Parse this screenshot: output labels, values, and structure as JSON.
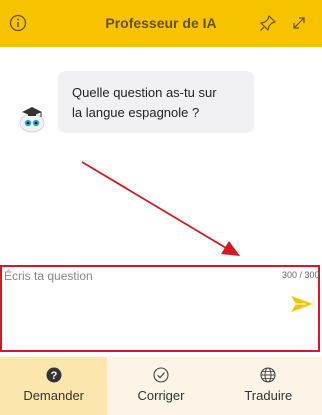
{
  "header": {
    "title": "Professeur de IA",
    "info_icon": "info-icon",
    "pin_icon": "pin-icon",
    "expand_icon": "expand-icon"
  },
  "chat": {
    "messages": [
      {
        "sender": "bot",
        "avatar_icon": "graduate-bot-avatar",
        "text_line1": "Quelle question as-tu sur",
        "text_line2": "la langue espagnole ?"
      }
    ]
  },
  "input": {
    "placeholder": "Écris ta question",
    "counter": "300 / 300",
    "send_icon": "send-icon"
  },
  "tabs": [
    {
      "label": "Demander",
      "icon": "question-circle-icon",
      "active": true
    },
    {
      "label": "Corriger",
      "icon": "check-circle-icon",
      "active": false
    },
    {
      "label": "Traduire",
      "icon": "globe-icon",
      "active": false
    }
  ],
  "colors": {
    "header_bg": "#f7c300",
    "title": "#6b5200",
    "highlight_border": "#d11a24",
    "send_accent": "#f7c300",
    "active_tab_bg": "#fbe6ad",
    "tab_bg": "#fbf4e7"
  }
}
